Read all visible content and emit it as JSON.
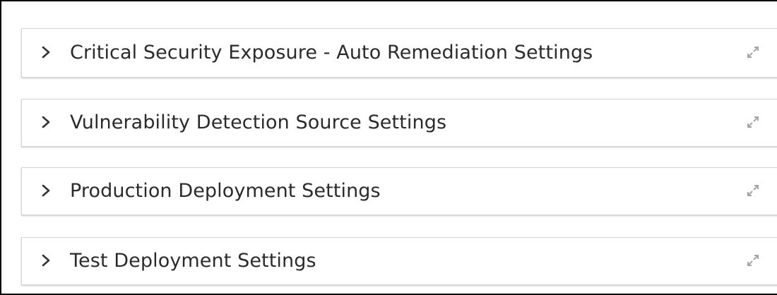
{
  "colors": {
    "panel_border": "#d4d4d4",
    "title_text": "#2b2b2b",
    "chevron": "#333333",
    "expand_icon": "#a6a6a6"
  },
  "panels": [
    {
      "title": "Critical Security Exposure - Auto Remediation Settings",
      "expanded": false,
      "chevron_icon": "chevron-right-icon",
      "expand_icon": "expand-icon"
    },
    {
      "title": "Vulnerability Detection Source Settings",
      "expanded": false,
      "chevron_icon": "chevron-right-icon",
      "expand_icon": "expand-icon"
    },
    {
      "title": "Production Deployment Settings",
      "expanded": false,
      "chevron_icon": "chevron-right-icon",
      "expand_icon": "expand-icon"
    },
    {
      "title": "Test Deployment Settings",
      "expanded": false,
      "chevron_icon": "chevron-right-icon",
      "expand_icon": "expand-icon"
    }
  ]
}
